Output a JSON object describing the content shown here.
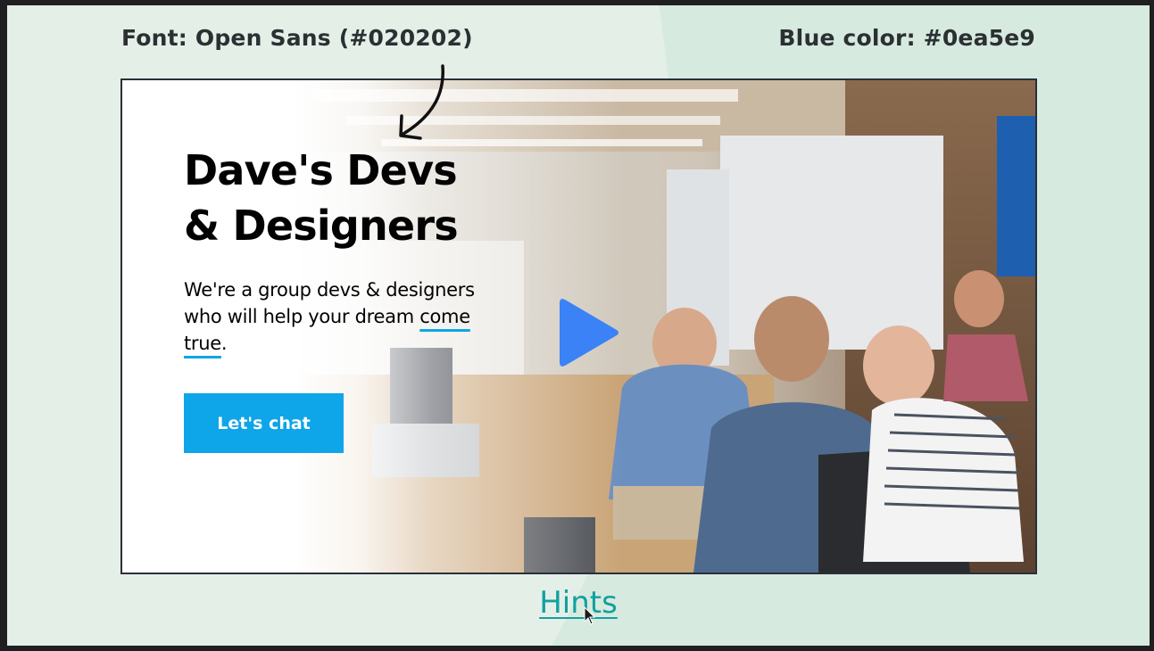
{
  "annotations": {
    "font_label": "Font: Open Sans (#020202)",
    "color_label": "Blue color: #0ea5e9"
  },
  "hero": {
    "title_line1": "Dave's Devs",
    "title_line2": "& Designers",
    "subtitle_part1": "We're a group devs & designers who will help your dream ",
    "subtitle_highlight": "come true",
    "subtitle_end": ".",
    "cta_label": "Let's chat"
  },
  "footer": {
    "hints_link": "Hints"
  },
  "colors": {
    "text": "#020202",
    "accent_blue": "#0ea5e9",
    "play_blue": "#3b82f6",
    "hints_link": "#14a0a0",
    "background": "#e4efe8"
  },
  "icons": {
    "play": "play-icon",
    "annotation_arrow": "curved-arrow-icon",
    "cursor": "mouse-pointer-icon"
  }
}
